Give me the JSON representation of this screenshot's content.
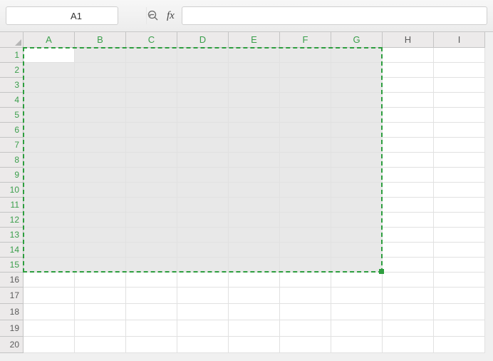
{
  "toolbar": {
    "name_box_value": "A1",
    "fx_label": "fx",
    "formula_value": ""
  },
  "grid": {
    "columns": [
      "A",
      "B",
      "C",
      "D",
      "E",
      "F",
      "G",
      "H",
      "I"
    ],
    "rows_visible": 20,
    "row_height_main": 21,
    "row_height_alt": 23,
    "alt_rows": [
      17,
      18,
      19,
      20
    ],
    "selected_cols": [
      "A",
      "B",
      "C",
      "D",
      "E",
      "F",
      "G"
    ],
    "selected_rows_start": 1,
    "selected_rows_end": 15,
    "active_cell": {
      "col": "A",
      "row": 1
    },
    "accent_color": "#2e9e3f"
  }
}
